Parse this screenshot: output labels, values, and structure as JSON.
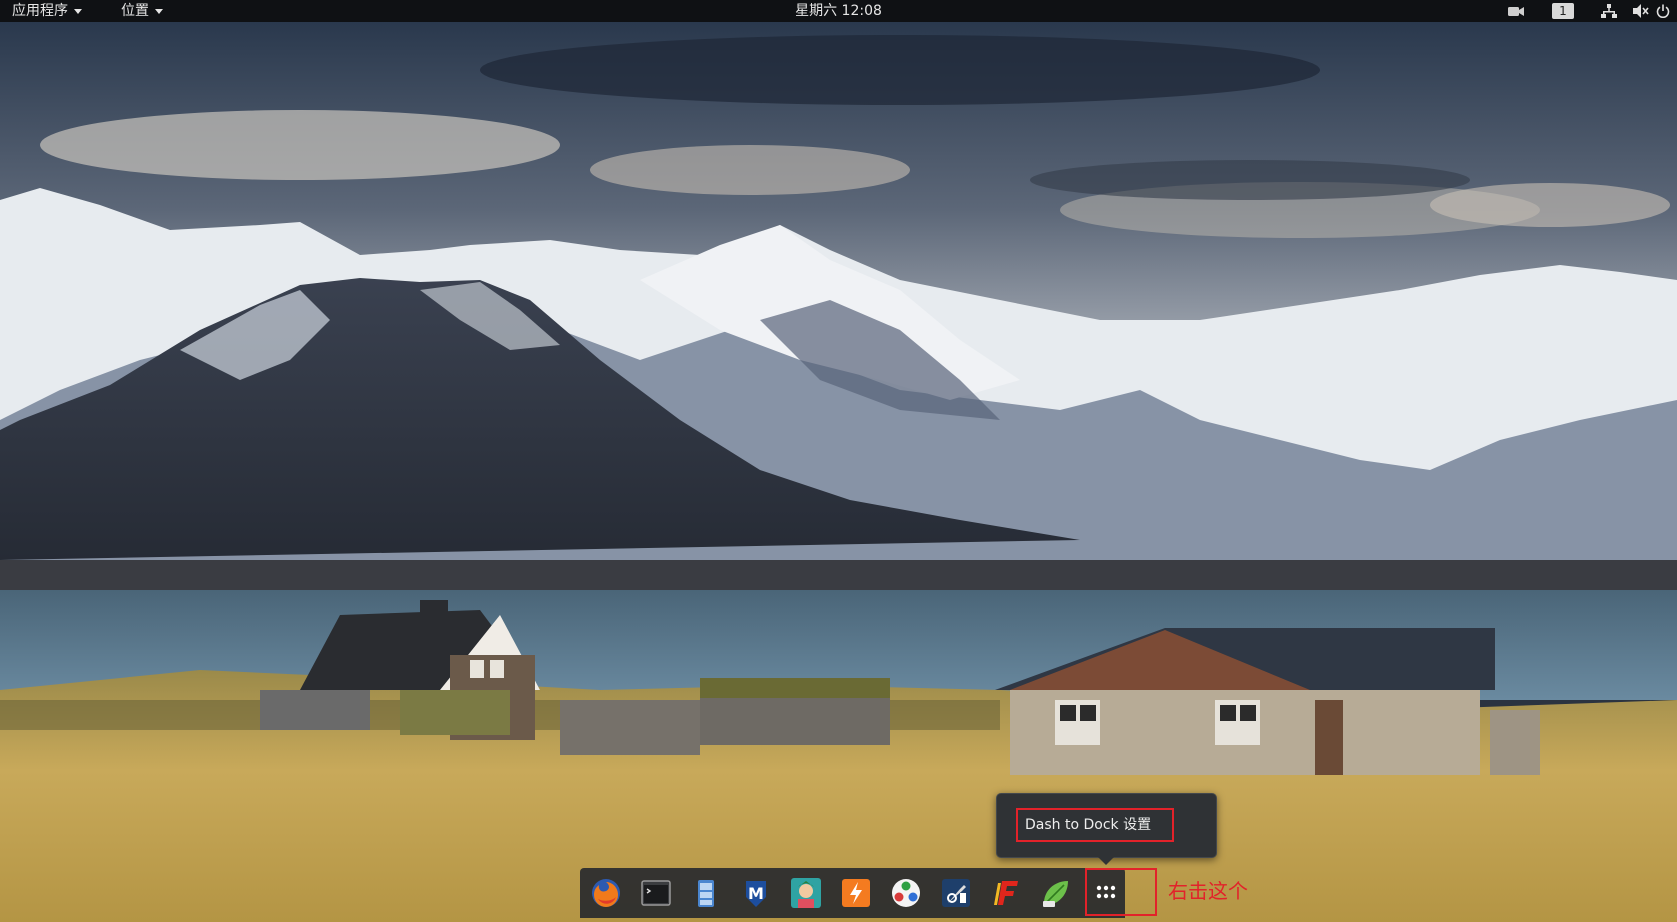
{
  "topbar": {
    "applications_label": "应用程序",
    "places_label": "位置",
    "clock": "星期六 12:08",
    "workspace_number": "1"
  },
  "popup": {
    "item_label": "Dash to Dock 设置"
  },
  "annotation": {
    "text": "右击这个"
  },
  "dock": {
    "items": [
      {
        "name": "firefox-icon"
      },
      {
        "name": "terminal-icon"
      },
      {
        "name": "file-manager-icon"
      },
      {
        "name": "maltego-icon"
      },
      {
        "name": "avatar-app-icon"
      },
      {
        "name": "burpsuite-icon"
      },
      {
        "name": "armitage-icon"
      },
      {
        "name": "tool-icon"
      },
      {
        "name": "faraday-icon"
      },
      {
        "name": "leafpad-icon"
      },
      {
        "name": "show-applications-icon"
      }
    ]
  },
  "colors": {
    "annotation_red": "#e2222a",
    "topbar_bg": "#0f1114",
    "dock_bg": "#282a2e"
  }
}
